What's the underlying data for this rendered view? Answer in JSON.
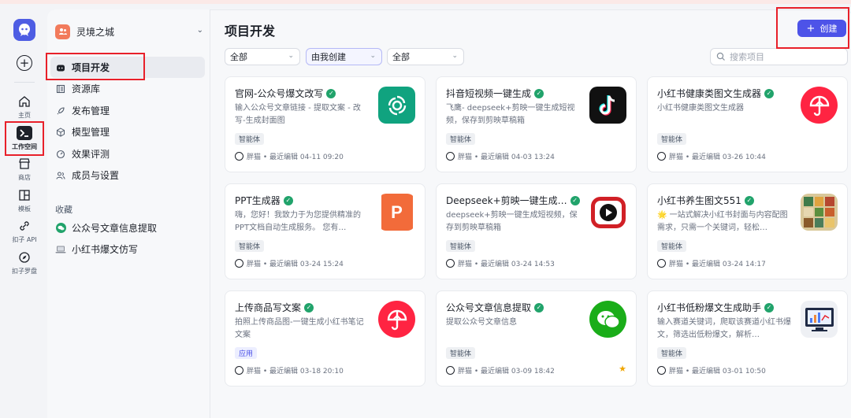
{
  "rail": {
    "items": [
      {
        "label": "主页"
      },
      {
        "label": "工作空间"
      },
      {
        "label": "商店"
      },
      {
        "label": "模板"
      },
      {
        "label": "扣子 API"
      },
      {
        "label": "扣子罗盘"
      }
    ]
  },
  "workspace": {
    "name": "灵境之城"
  },
  "sidebar": {
    "items": [
      {
        "label": "项目开发"
      },
      {
        "label": "资源库"
      },
      {
        "label": "发布管理"
      },
      {
        "label": "模型管理"
      },
      {
        "label": "效果评测"
      },
      {
        "label": "成员与设置"
      }
    ],
    "section_title": "收藏",
    "favorites": [
      {
        "label": "公众号文章信息提取"
      },
      {
        "label": "小红书爆文仿写"
      }
    ]
  },
  "main": {
    "title": "项目开发",
    "create_label": "创建",
    "filters": [
      "全部",
      "由我创建",
      "全部"
    ],
    "search_placeholder": "搜索项目"
  },
  "cards": [
    {
      "title": "官网-公众号爆文改写",
      "desc": "输入公众号文章链接 - 提取文案 - 改写-生成封面图",
      "tag": "智能体",
      "meta": "胖猫 • 最近编辑 04-11 09:20",
      "icon": "chatgpt-icon"
    },
    {
      "title": "抖音短视频一键生成",
      "desc": "飞鹰- deepseek+剪映一键生成短视频，保存到剪映草稿箱",
      "tag": "智能体",
      "meta": "胖猫 • 最近编辑 04-03 13:24",
      "icon": "tiktok-icon"
    },
    {
      "title": "小红书健康类图文生成器",
      "desc": "小红书健康类图文生成器",
      "tag": "智能体",
      "meta": "胖猫 • 最近编辑 03-26 10:44",
      "icon": "umbrella-icon"
    },
    {
      "title": "PPT生成器",
      "desc": "嗨，您好！我致力于为您提供精准的PPT文档自动生成服务。 您有…",
      "tag": "智能体",
      "meta": "胖猫 • 最近编辑 03-24 15:24",
      "icon": "ppt-icon"
    },
    {
      "title": "Deepseek+剪映一键生成…",
      "desc": "deepseek+剪映一键生成短视频，保存到剪映草稿箱",
      "tag": "智能体",
      "meta": "胖猫 • 最近编辑 03-24 14:53",
      "icon": "play-icon"
    },
    {
      "title": "小红书养生图文551",
      "desc": "🌟 一站式解决小红书封面与内容配图需求，只需一个关键词，轻松…",
      "tag": "智能体",
      "meta": "胖猫 • 最近编辑 03-24 14:17",
      "icon": "collage-icon"
    },
    {
      "title": "上传商品写文案",
      "desc": "拍照上传商品图-一键生成小红书笔记文案",
      "tag": "应用",
      "meta": "胖猫 • 最近编辑 03-18 20:10",
      "icon": "umbrella-icon"
    },
    {
      "title": "公众号文章信息提取",
      "desc": "提取公众号文章信息",
      "tag": "智能体",
      "meta": "胖猫 • 最近编辑 03-09 18:42",
      "icon": "wechat-icon"
    },
    {
      "title": "小红书低粉爆文生成助手",
      "desc": "输入赛道关键词，爬取该赛道小红书爆文，筛选出低粉爆文，解析…",
      "tag": "智能体",
      "meta": "胖猫 • 最近编辑 03-01 10:50",
      "icon": "monitor-icon"
    }
  ],
  "colors": {
    "accent": "#4d53e8",
    "verified": "#21a36b",
    "annotation": "#e8202a"
  }
}
